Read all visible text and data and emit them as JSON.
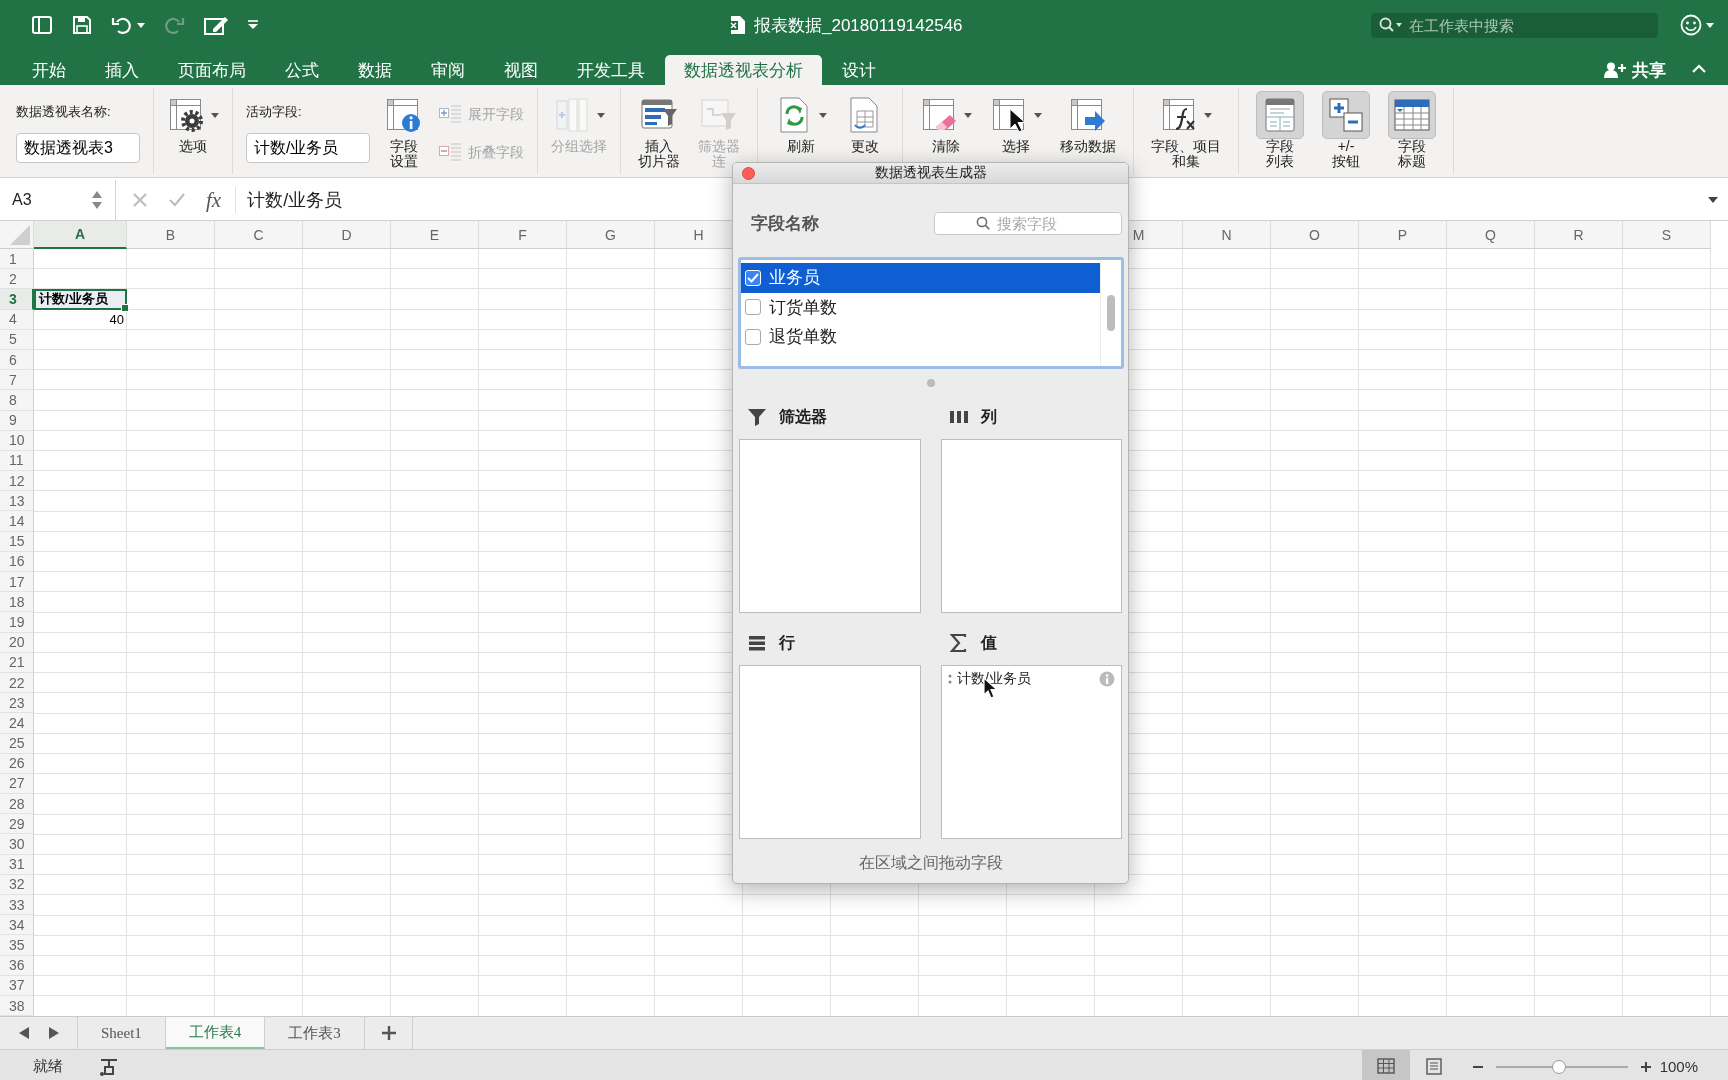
{
  "title_bar": {
    "title": "报表数据_20180119142546",
    "search": {
      "placeholder": "在工作表中搜索"
    }
  },
  "tabs": [
    {
      "label": "开始",
      "selected": false
    },
    {
      "label": "插入",
      "selected": false
    },
    {
      "label": "页面布局",
      "selected": false
    },
    {
      "label": "公式",
      "selected": false
    },
    {
      "label": "数据",
      "selected": false
    },
    {
      "label": "审阅",
      "selected": false
    },
    {
      "label": "视图",
      "selected": false
    },
    {
      "label": "开发工具",
      "selected": false
    },
    {
      "label": "数据透视表分析",
      "selected": true
    },
    {
      "label": "设计",
      "selected": false
    }
  ],
  "share": {
    "label": "共享"
  },
  "ribbon": {
    "groups": [
      {
        "items": [
          {
            "kind": "name_field",
            "label": "数据透视表名称:",
            "value": "数据透视表3"
          }
        ]
      },
      {
        "items": [
          {
            "kind": "options",
            "lines": [
              "选项"
            ],
            "dropdown": true,
            "disabled": false,
            "on": false
          }
        ]
      },
      {
        "items": [
          {
            "kind": "name_field",
            "label": "活动字段:",
            "value": "计数/业务员"
          },
          {
            "kind": "fieldsettings",
            "lines": [
              "字段",
              "设置"
            ],
            "dropdown": false,
            "disabled": false,
            "on": false
          },
          {
            "kind": "stack",
            "buttons": [
              {
                "kind": "expand",
                "label": "展开字段",
                "disabled": true
              },
              {
                "kind": "collapse",
                "label": "折叠字段",
                "disabled": true
              }
            ]
          }
        ]
      },
      {
        "items": [
          {
            "kind": "group",
            "lines": [
              "分组选择"
            ],
            "dropdown": true,
            "disabled": true,
            "on": false
          }
        ]
      },
      {
        "items": [
          {
            "kind": "slicer",
            "lines": [
              "插入",
              "切片器"
            ],
            "dropdown": false,
            "disabled": false,
            "on": false
          },
          {
            "kind": "filterlinks",
            "lines": [
              "筛选器",
              "连"
            ],
            "dropdown": false,
            "disabled": true,
            "on": false
          }
        ]
      },
      {
        "items": [
          {
            "kind": "refresh",
            "lines": [
              "刷新"
            ],
            "dropdown": true,
            "disabled": false,
            "on": false
          },
          {
            "kind": "changesource",
            "lines": [
              "更改"
            ],
            "dropdown": false,
            "disabled": false,
            "on": false
          }
        ]
      },
      {
        "items": [
          {
            "kind": "clear",
            "lines": [
              "清除"
            ],
            "dropdown": true,
            "disabled": false,
            "on": false
          },
          {
            "kind": "select",
            "lines": [
              "选择"
            ],
            "dropdown": true,
            "disabled": false,
            "on": false
          },
          {
            "kind": "move",
            "lines": [
              "移动数据"
            ],
            "dropdown": false,
            "disabled": false,
            "on": false
          }
        ]
      },
      {
        "items": [
          {
            "kind": "calc",
            "lines": [
              "字段、项目",
              "和集"
            ],
            "dropdown": true,
            "disabled": false,
            "on": false
          }
        ]
      },
      {
        "items": [
          {
            "kind": "fieldlist",
            "lines": [
              "字段",
              "列表"
            ],
            "dropdown": false,
            "disabled": false,
            "on": true
          },
          {
            "kind": "plusminus",
            "lines": [
              "+/-",
              "按钮"
            ],
            "dropdown": false,
            "disabled": false,
            "on": true
          },
          {
            "kind": "headers",
            "lines": [
              "字段",
              "标题"
            ],
            "dropdown": false,
            "disabled": false,
            "on": true
          }
        ]
      }
    ]
  },
  "formula_bar": {
    "name_box": "A3",
    "fx": "fx",
    "formula": "计数/业务员"
  },
  "sheet": {
    "columns_left": [
      {
        "label": "A",
        "selected": true
      },
      {
        "label": "B",
        "selected": false
      },
      {
        "label": "C",
        "selected": false
      },
      {
        "label": "D",
        "selected": false
      },
      {
        "label": "E",
        "selected": false
      },
      {
        "label": "F",
        "selected": false
      },
      {
        "label": "G",
        "selected": false
      },
      {
        "label": "H",
        "selected": false
      }
    ],
    "columns_right": [
      {
        "label": "M",
        "selected": false
      },
      {
        "label": "N",
        "selected": false
      },
      {
        "label": "O",
        "selected": false
      },
      {
        "label": "P",
        "selected": false
      },
      {
        "label": "Q",
        "selected": false
      },
      {
        "label": "R",
        "selected": false
      },
      {
        "label": "S",
        "selected": false
      }
    ],
    "rows": [
      {
        "label": "1",
        "selected": false
      },
      {
        "label": "2",
        "selected": false
      },
      {
        "label": "3",
        "selected": true,
        "cells": [
          {
            "text": "计数/业务员",
            "kind": "header",
            "selected": true
          }
        ]
      },
      {
        "label": "4",
        "selected": false,
        "cells": [
          {
            "text": "40",
            "kind": "number",
            "selected": false
          }
        ]
      },
      {
        "label": "5",
        "selected": false
      },
      {
        "label": "6",
        "selected": false
      },
      {
        "label": "7",
        "selected": false
      },
      {
        "label": "8",
        "selected": false
      },
      {
        "label": "9",
        "selected": false
      },
      {
        "label": "10",
        "selected": false
      },
      {
        "label": "11",
        "selected": false
      },
      {
        "label": "12",
        "selected": false
      },
      {
        "label": "13",
        "selected": false
      },
      {
        "label": "14",
        "selected": false
      },
      {
        "label": "15",
        "selected": false
      },
      {
        "label": "16",
        "selected": false
      },
      {
        "label": "17",
        "selected": false
      },
      {
        "label": "18",
        "selected": false
      },
      {
        "label": "19",
        "selected": false
      },
      {
        "label": "20",
        "selected": false
      },
      {
        "label": "21",
        "selected": false
      },
      {
        "label": "22",
        "selected": false
      },
      {
        "label": "23",
        "selected": false
      },
      {
        "label": "24",
        "selected": false
      },
      {
        "label": "25",
        "selected": false
      },
      {
        "label": "26",
        "selected": false
      },
      {
        "label": "27",
        "selected": false
      },
      {
        "label": "28",
        "selected": false
      },
      {
        "label": "29",
        "selected": false
      },
      {
        "label": "30",
        "selected": false
      },
      {
        "label": "31",
        "selected": false
      },
      {
        "label": "32",
        "selected": false
      },
      {
        "label": "33",
        "selected": false
      },
      {
        "label": "34",
        "selected": false
      },
      {
        "label": "35",
        "selected": false
      },
      {
        "label": "36",
        "selected": false
      },
      {
        "label": "37",
        "selected": false
      },
      {
        "label": "38",
        "selected": false
      }
    ]
  },
  "sheet_tabs": [
    {
      "label": "Sheet1",
      "selected": false
    },
    {
      "label": "工作表4",
      "selected": true
    },
    {
      "label": "工作表3",
      "selected": false
    }
  ],
  "status_bar": {
    "status": "就绪",
    "views": [
      {
        "kind": "normal",
        "selected": true
      },
      {
        "kind": "page_layout",
        "selected": false
      }
    ],
    "zoom": {
      "level": 0.48,
      "reading": "100%"
    }
  },
  "pivot_builder": {
    "title": "数据透视表生成器",
    "field_header": "字段名称",
    "search": {
      "placeholder": "搜索字段"
    },
    "fields": [
      {
        "label": "业务员",
        "checked": true,
        "selected": true
      },
      {
        "label": "订货单数",
        "checked": false,
        "selected": false
      },
      {
        "label": "退货单数",
        "checked": false,
        "selected": false
      }
    ],
    "areas": [
      {
        "kind": "filters",
        "label": "筛选器"
      },
      {
        "kind": "columns",
        "label": "列"
      },
      {
        "kind": "rows",
        "label": "行"
      },
      {
        "kind": "values",
        "label": "值",
        "items": [
          {
            "label": "计数/业务员"
          }
        ]
      }
    ],
    "footer": "在区域之间拖动字段"
  }
}
